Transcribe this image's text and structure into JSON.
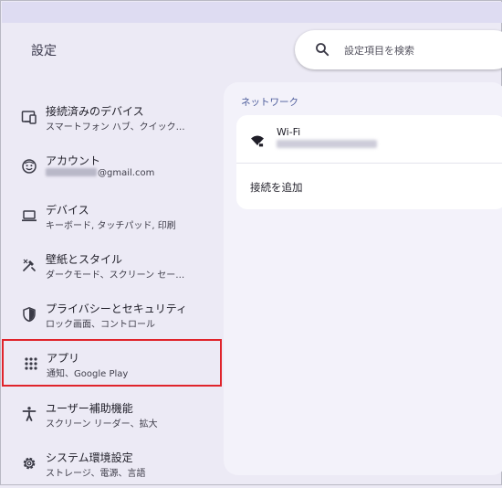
{
  "header": {
    "title": "設定",
    "search_placeholder": "設定項目を検索"
  },
  "sidebar": {
    "items": [
      {
        "label": "接続済みのデバイス",
        "sub": "スマートフォン ハブ、クイック…",
        "icon": "connected-devices-icon"
      },
      {
        "label": "アカウント",
        "sub": "@gmail.com",
        "icon": "account-icon"
      },
      {
        "label": "デバイス",
        "sub": "キーボード, タッチパッド, 印刷",
        "icon": "laptop-icon"
      },
      {
        "label": "壁紙とスタイル",
        "sub": "ダークモード、スクリーン セー…",
        "icon": "palette-brush-icon"
      },
      {
        "label": "プライバシーとセキュリティ",
        "sub": "ロック画面、コントロール",
        "icon": "shield-icon"
      },
      {
        "label": "アプリ",
        "sub": "通知、Google Play",
        "icon": "apps-grid-icon",
        "selected": true
      },
      {
        "label": "ユーザー補助機能",
        "sub": "スクリーン リーダー、拡大",
        "icon": "accessibility-icon"
      },
      {
        "label": "システム環境設定",
        "sub": "ストレージ、電源、言語",
        "icon": "gear-icon"
      }
    ]
  },
  "main": {
    "section_title": "ネットワーク",
    "wifi_label": "Wi-Fi",
    "add_connection": "接続を追加"
  },
  "colors": {
    "background": "#eceaf5",
    "selection_outline": "#e0242b",
    "section_title": "#4a5a9a"
  }
}
